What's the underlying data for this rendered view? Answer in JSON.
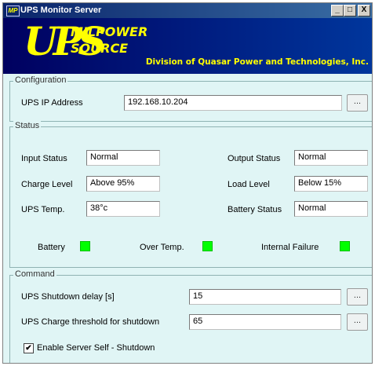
{
  "window": {
    "title": "UPS Monitor Server",
    "app_icon_text": "MP",
    "controls": {
      "minimize": "_",
      "maximize": "□",
      "close": "X"
    }
  },
  "banner": {
    "logo_big": "UPS",
    "logo_line1": "MILPOWER",
    "logo_line2": "SOURCE",
    "division_text": "Division of Quasar Power and Technologies, Inc."
  },
  "configuration": {
    "legend": "Configuration",
    "ip_label": "UPS IP Address",
    "ip_value": "192.168.10.204",
    "browse_label": "..."
  },
  "status": {
    "legend": "Status",
    "input_status_label": "Input Status",
    "input_status_value": "Normal",
    "output_status_label": "Output Status",
    "output_status_value": "Normal",
    "charge_level_label": "Charge Level",
    "charge_level_value": "Above 95%",
    "load_level_label": "Load Level",
    "load_level_value": "Below 15%",
    "ups_temp_label": "UPS Temp.",
    "ups_temp_value": "38°c",
    "battery_status_label": "Battery Status",
    "battery_status_value": "Normal",
    "indicators": {
      "battery": "Battery",
      "over_temp": "Over Temp.",
      "internal_failure": "Internal Failure"
    },
    "indicator_color": "#00ff00"
  },
  "command": {
    "legend": "Command",
    "shutdown_delay_label": "UPS Shutdown delay [s]",
    "shutdown_delay_value": "15",
    "charge_threshold_label": "UPS Charge threshold for shutdown",
    "charge_threshold_value": "65",
    "browse_label": "...",
    "self_shutdown_label": "Enable Server Self - Shutdown",
    "self_shutdown_check": "✔"
  }
}
